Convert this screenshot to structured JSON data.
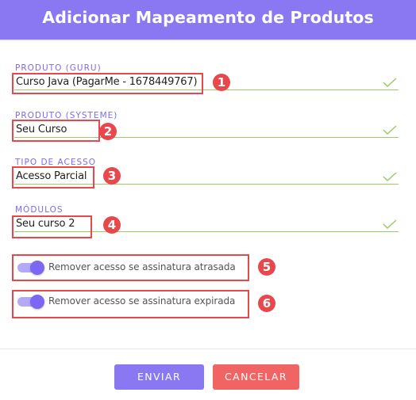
{
  "header": {
    "title": "Adicionar Mapeamento de Produtos"
  },
  "fields": [
    {
      "label": "PRODUTO (GURU)",
      "value": "Curso Java (PagarMe - 1678449767)",
      "badge": "1"
    },
    {
      "label": "PRODUTO (SYSTEME)",
      "value": "Seu Curso",
      "badge": "2"
    },
    {
      "label": "TIPO DE ACESSO",
      "value": "Acesso Parcial",
      "badge": "3"
    },
    {
      "label": "MÓDULOS",
      "value": "Seu curso 2",
      "badge": "4"
    }
  ],
  "toggles": [
    {
      "label": "Remover acesso se assinatura atrasada",
      "checked": true,
      "badge": "5"
    },
    {
      "label": "Remover acesso se assinatura expirada",
      "checked": true,
      "badge": "6"
    }
  ],
  "actions": {
    "submit": "ENVIAR",
    "cancel": "CANCELAR"
  },
  "icons": {
    "valid": "check-icon"
  },
  "colors": {
    "primary": "#8a78f2",
    "label": "#7b6cf0",
    "valid": "#9ccc65",
    "highlight": "#e8474c",
    "cancel": "#f06464"
  }
}
